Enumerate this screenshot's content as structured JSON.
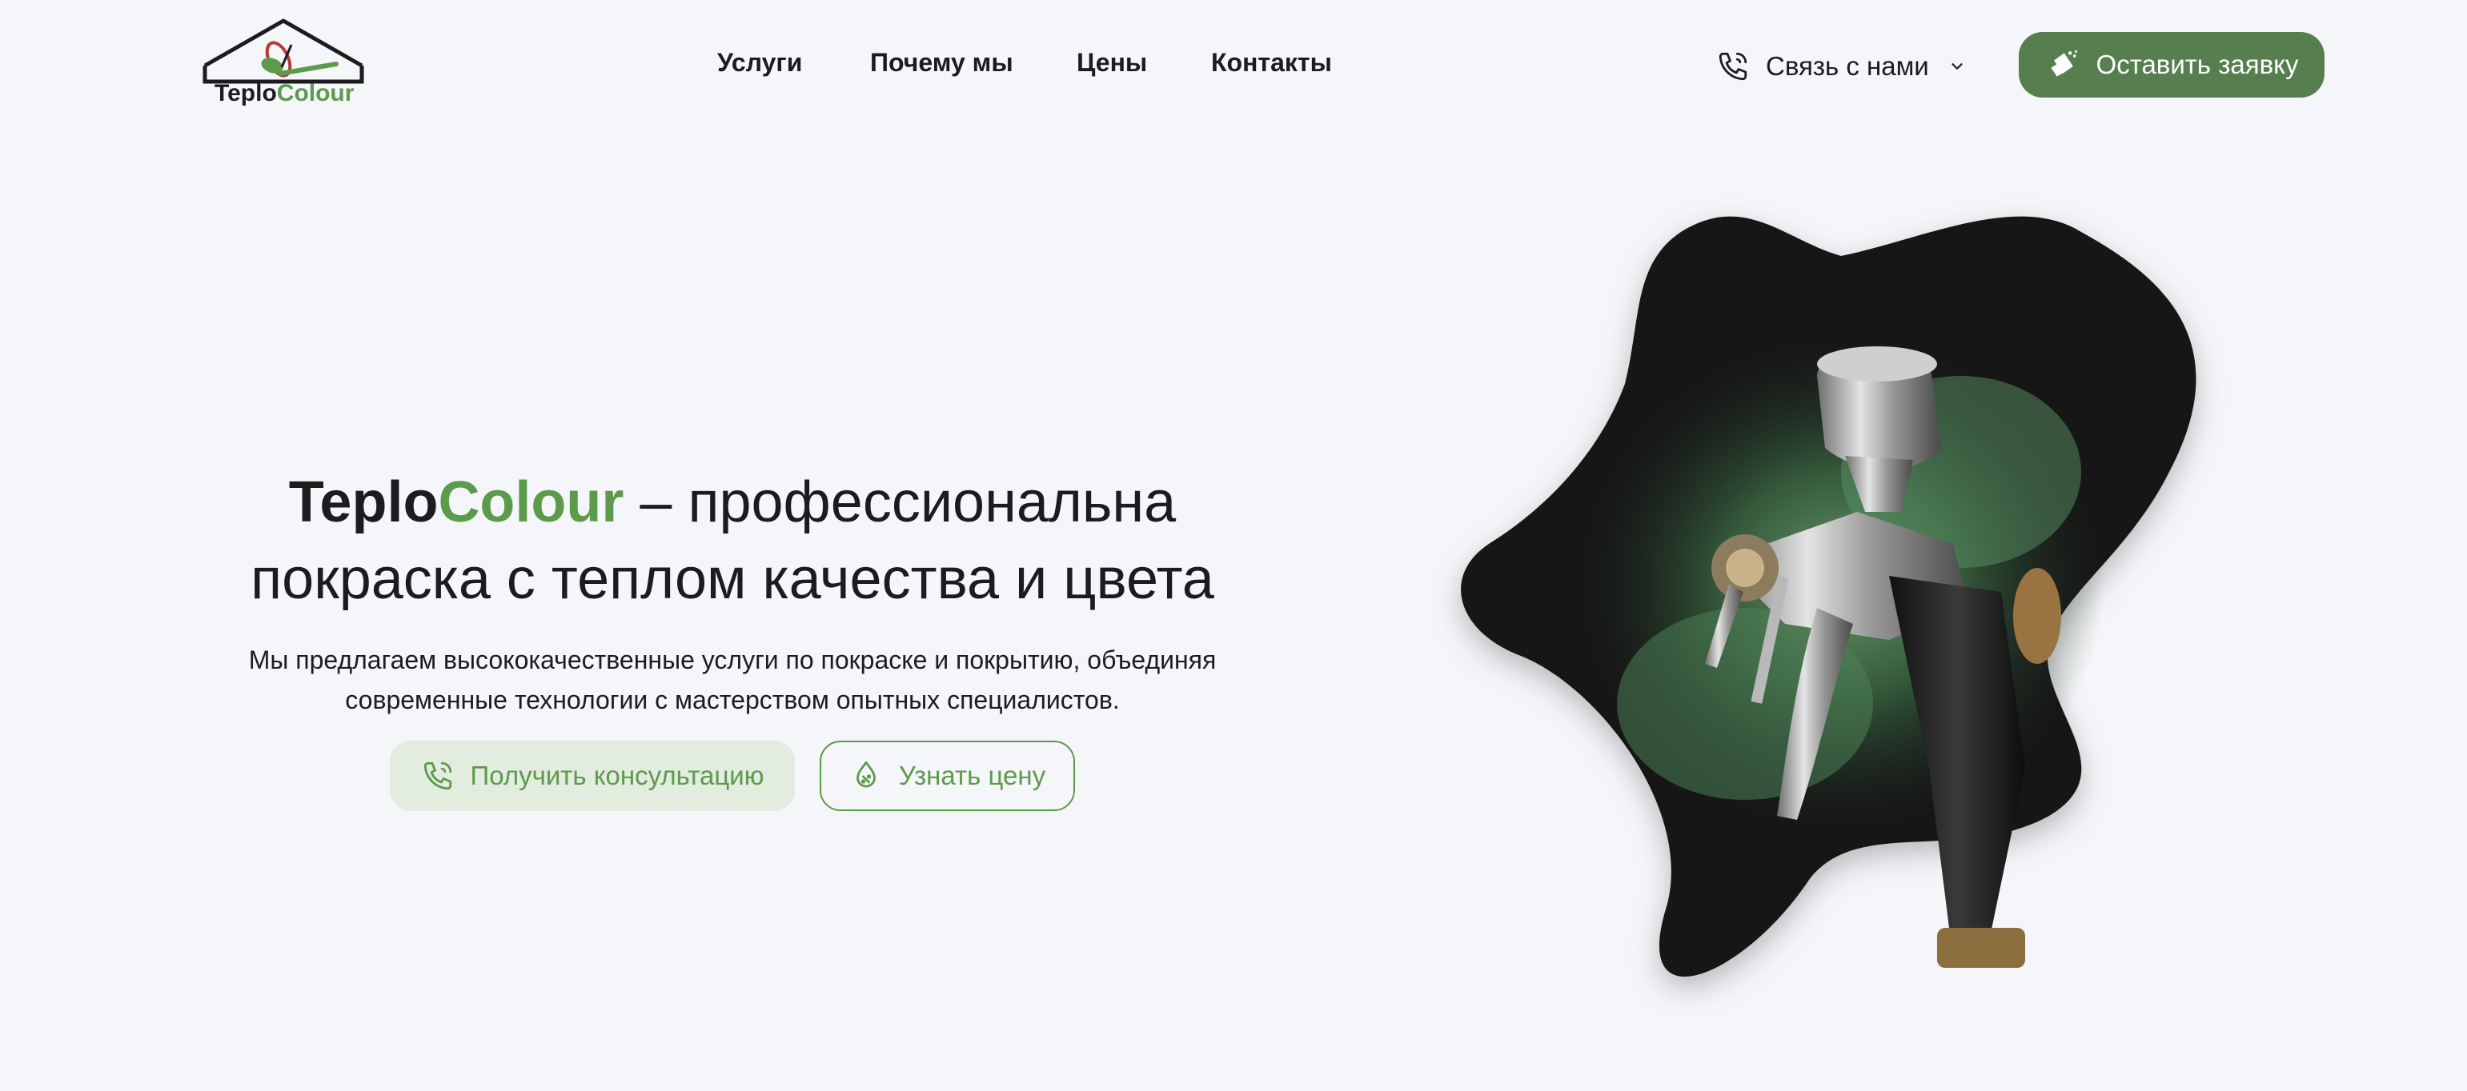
{
  "header": {
    "logo": {
      "part1": "Teplo",
      "part2": "Colour"
    },
    "nav": [
      {
        "label": "Услуги"
      },
      {
        "label": "Почему мы"
      },
      {
        "label": "Цены"
      },
      {
        "label": "Контакты"
      }
    ],
    "contact": {
      "label": "Связь с нами",
      "icon": "phone-icon",
      "chevron": "chevron-down-icon"
    },
    "cta": {
      "label": "Оставить заявку",
      "icon": "spray-can-icon"
    }
  },
  "hero": {
    "title_brand_1": "Teplo",
    "title_brand_2": "Colour",
    "title_rest_line1": " – профессиональна",
    "title_line2": "покраска с теплом качества и цвета",
    "subtitle_line1": "Мы предлагаем высококачественные услуги по покраске и покрытию, объединяя",
    "subtitle_line2": "современные технологии с мастерством опытных специалистов.",
    "buttons": [
      {
        "label": "Получить консультацию",
        "icon": "phone-icon"
      },
      {
        "label": "Узнать цену",
        "icon": "price-drop-icon"
      }
    ],
    "image": {
      "subject": "spray-paint-gun-with-green-smoke"
    }
  },
  "colors": {
    "background": "#f5f6f9",
    "accent_green": "#5c9a4c",
    "cta_green": "#567e4e",
    "light_green": "#e2ecdf",
    "text_dark": "#1c1c1f"
  }
}
